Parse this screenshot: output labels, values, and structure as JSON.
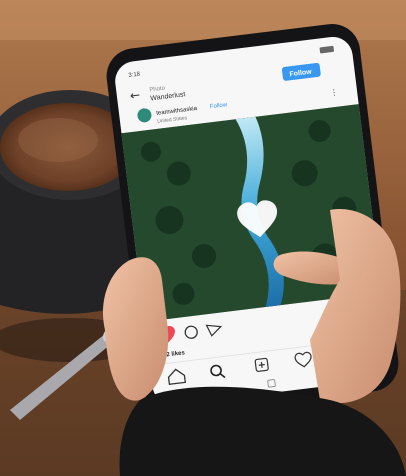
{
  "phone": {
    "status_bar": {
      "time": "3:18",
      "battery": ""
    },
    "header": {
      "posts_label": "Photo",
      "username": "Wanderlust",
      "follow_button_label": "Follow"
    },
    "post": {
      "author": "teamwithsaskia",
      "author_follow": "Follow",
      "location": "United States",
      "likes_text": "242 likes"
    },
    "nav_icons": [
      "home-icon",
      "search-icon",
      "add-post-icon",
      "heart-icon",
      "profile-icon"
    ],
    "system_nav_icons": [
      "back-nav-icon",
      "home-nav-icon",
      "recents-nav-icon"
    ]
  },
  "colors": {
    "follow_button": "#3897f0",
    "like_heart": "#ed4956",
    "table": "#7a4a2b",
    "coffee": "#5a2e18"
  }
}
